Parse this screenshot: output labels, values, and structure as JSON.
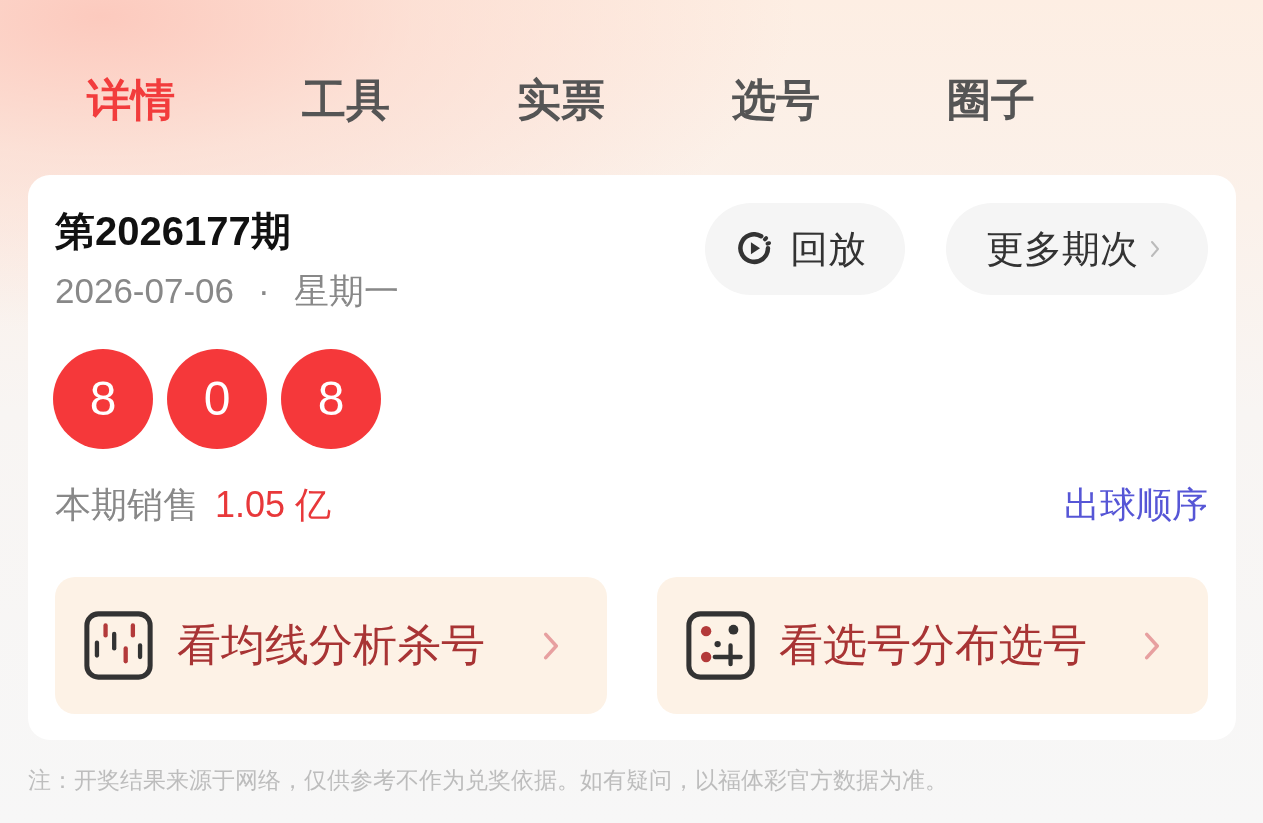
{
  "tabs": [
    {
      "label": "详情",
      "selected": true
    },
    {
      "label": "工具",
      "selected": false
    },
    {
      "label": "实票",
      "selected": false
    },
    {
      "label": "选号",
      "selected": false
    },
    {
      "label": "圈子",
      "selected": false
    }
  ],
  "draw": {
    "issue_title": "第2026177期",
    "date": "2026-07-06",
    "separator": "·",
    "weekday": "星期一",
    "buttons": [
      {
        "kind": "replay",
        "label": "回放"
      },
      {
        "kind": "more",
        "label": "更多期次"
      }
    ],
    "balls": [
      "8",
      "0",
      "8"
    ],
    "sales": {
      "label": "本期销售",
      "value": "1.05 亿"
    },
    "order_link": "出球顺序",
    "actions": [
      {
        "kind": "moving-average",
        "label": "看均线分析杀号"
      },
      {
        "kind": "distribution",
        "label": "看选号分布选号"
      }
    ]
  },
  "footnote": "注：开奖结果来源于网络，仅供参考不作为兑奖依据。如有疑问，以福体彩官方数据为准。"
}
